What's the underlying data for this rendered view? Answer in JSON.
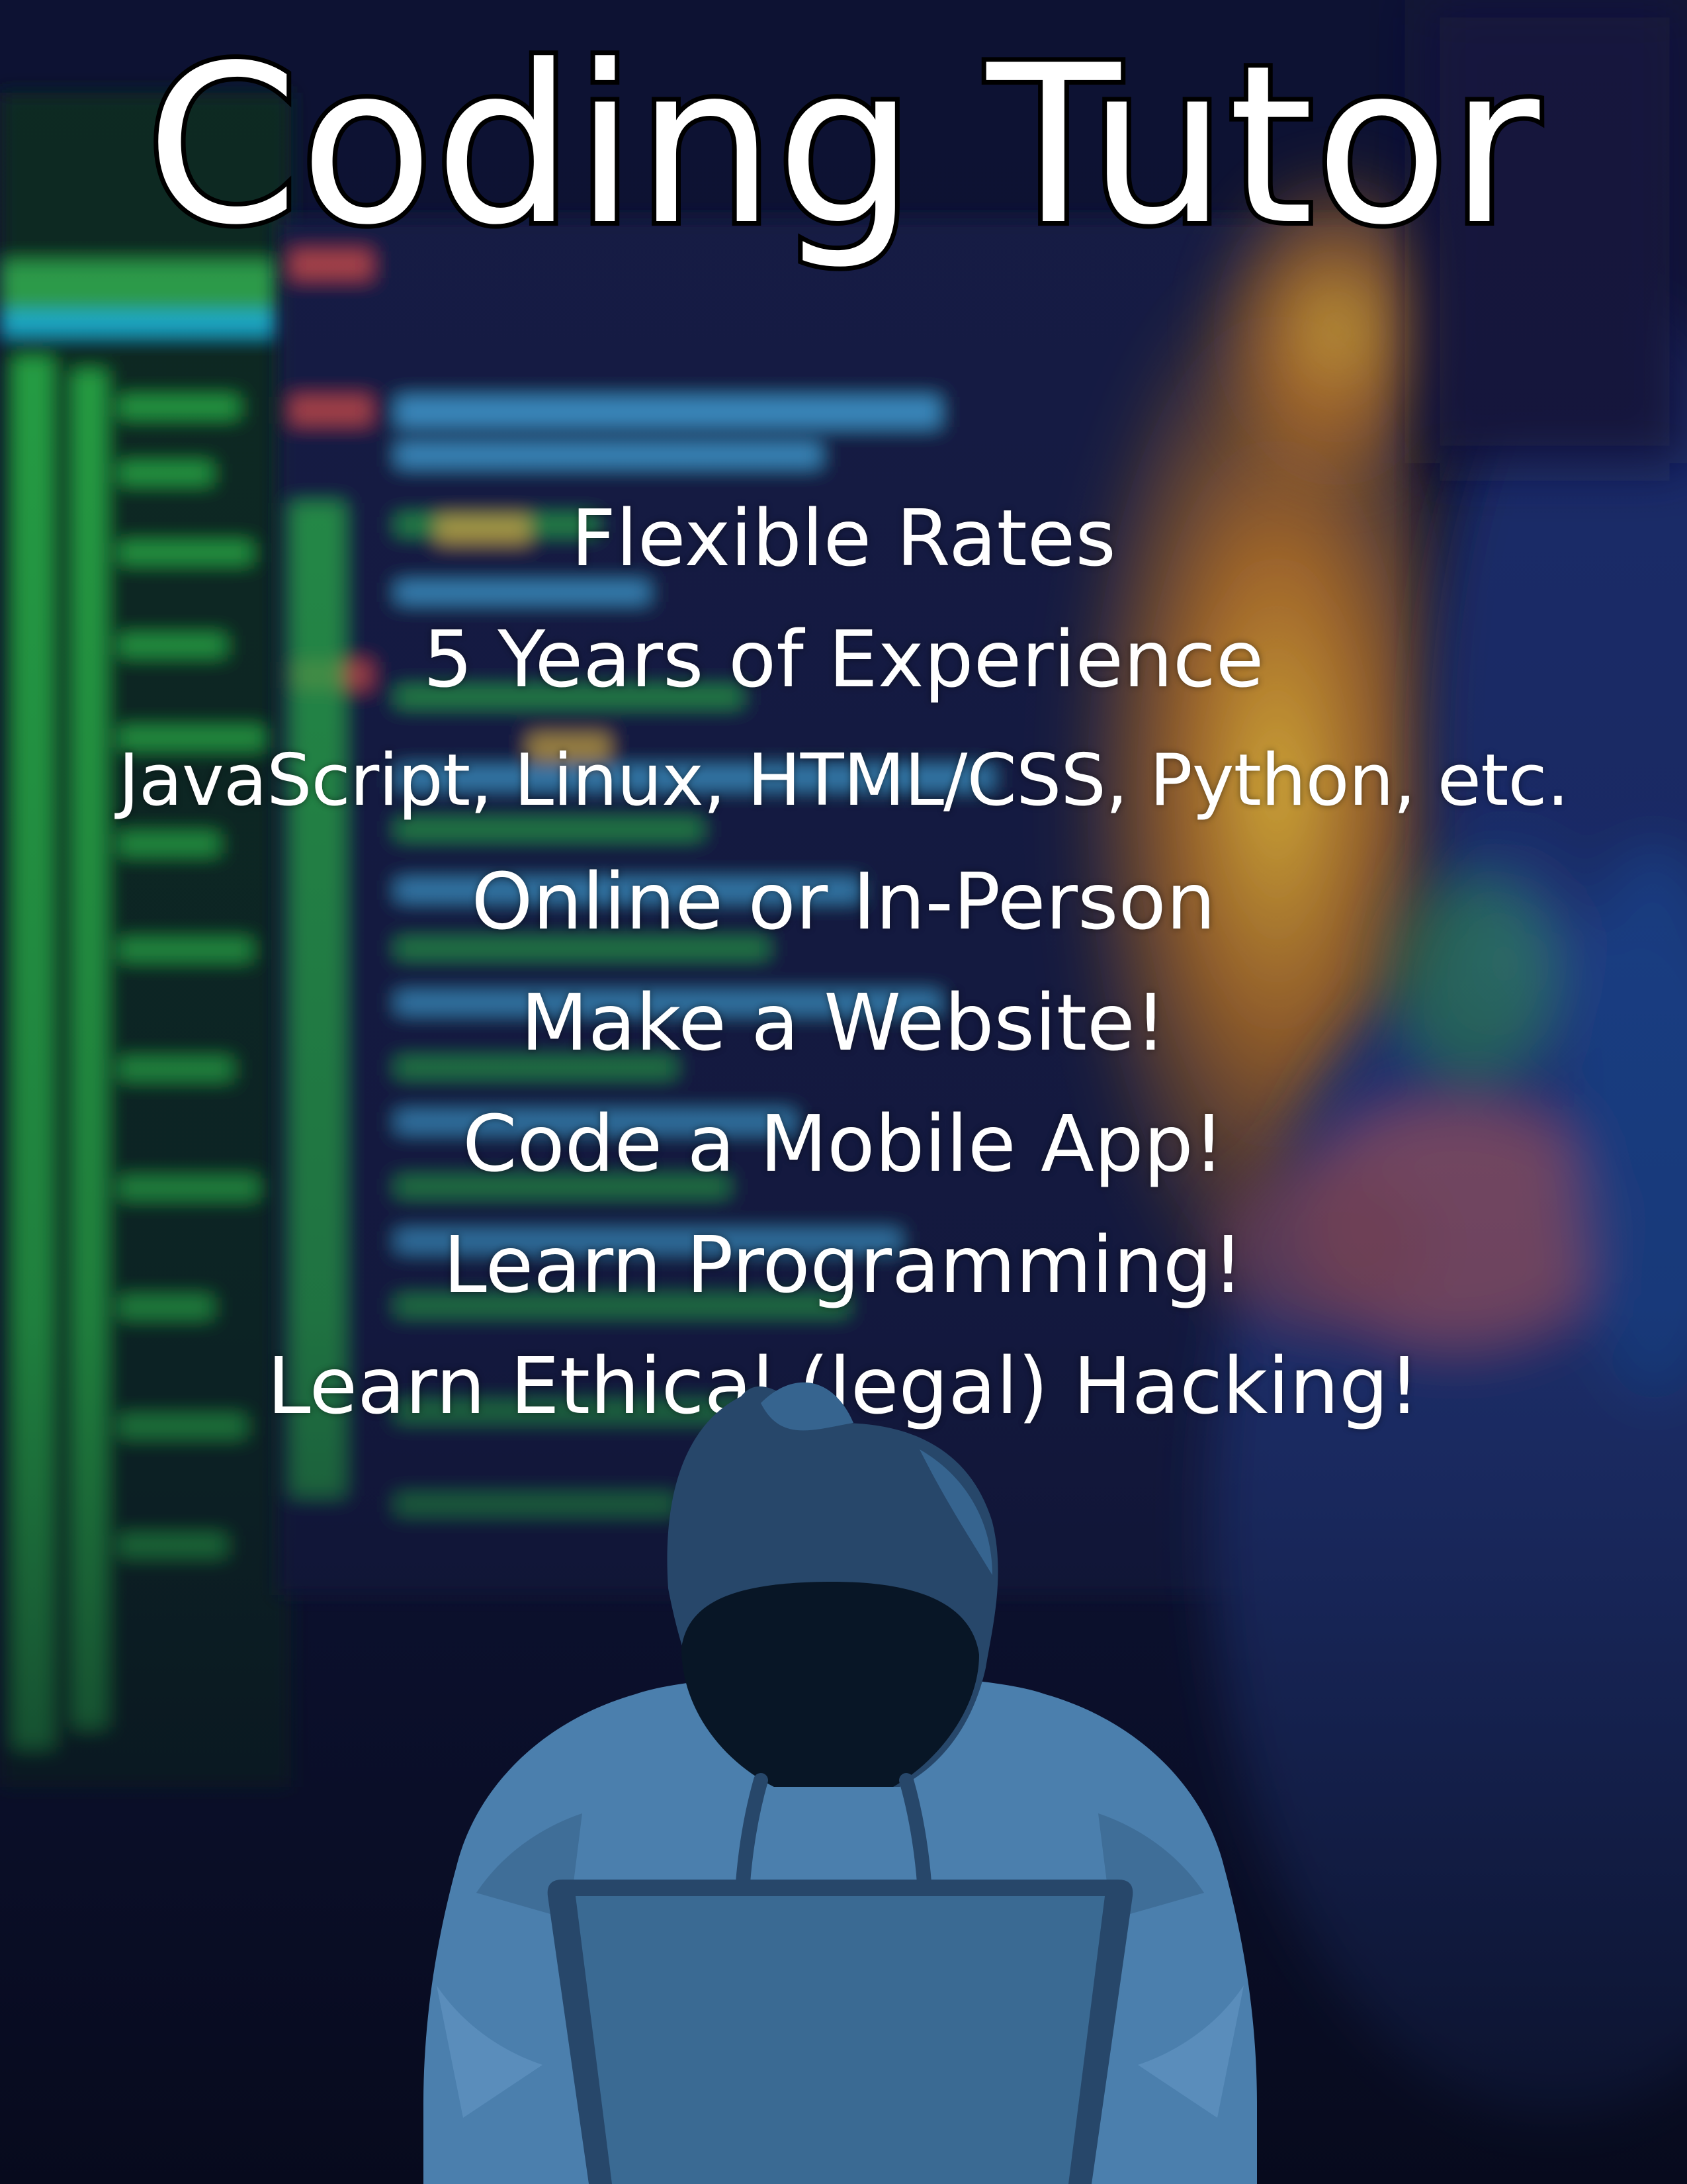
{
  "poster": {
    "title": "Coding Tutor",
    "features": [
      "Flexible Rates",
      "5 Years of Experience",
      "JavaScript, Linux, HTML/CSS, Python, etc.",
      "Online or In-Person",
      "Make a Website!",
      "Code a Mobile App!",
      "Learn Programming!",
      "Learn Ethical (legal) Hacking!"
    ]
  },
  "background": {
    "image": "blurred-code-monitor-photo",
    "colors": {
      "dark_navy": "#0b0f2a",
      "code_green": "#2bbd4a",
      "code_cyan": "#1fb3d4",
      "glow_orange": "#f0a128",
      "glow_yellow": "#ffd23a",
      "person_blue": "#2c5aa8"
    }
  },
  "illustration": {
    "icon": "hooded-hacker-with-laptop-icon",
    "colors": {
      "hood_dark": "#27476a",
      "hood_mid": "#36648f",
      "jacket": "#4b7fad",
      "face_shadow": "#081626",
      "laptop": "#3a6a93"
    }
  }
}
